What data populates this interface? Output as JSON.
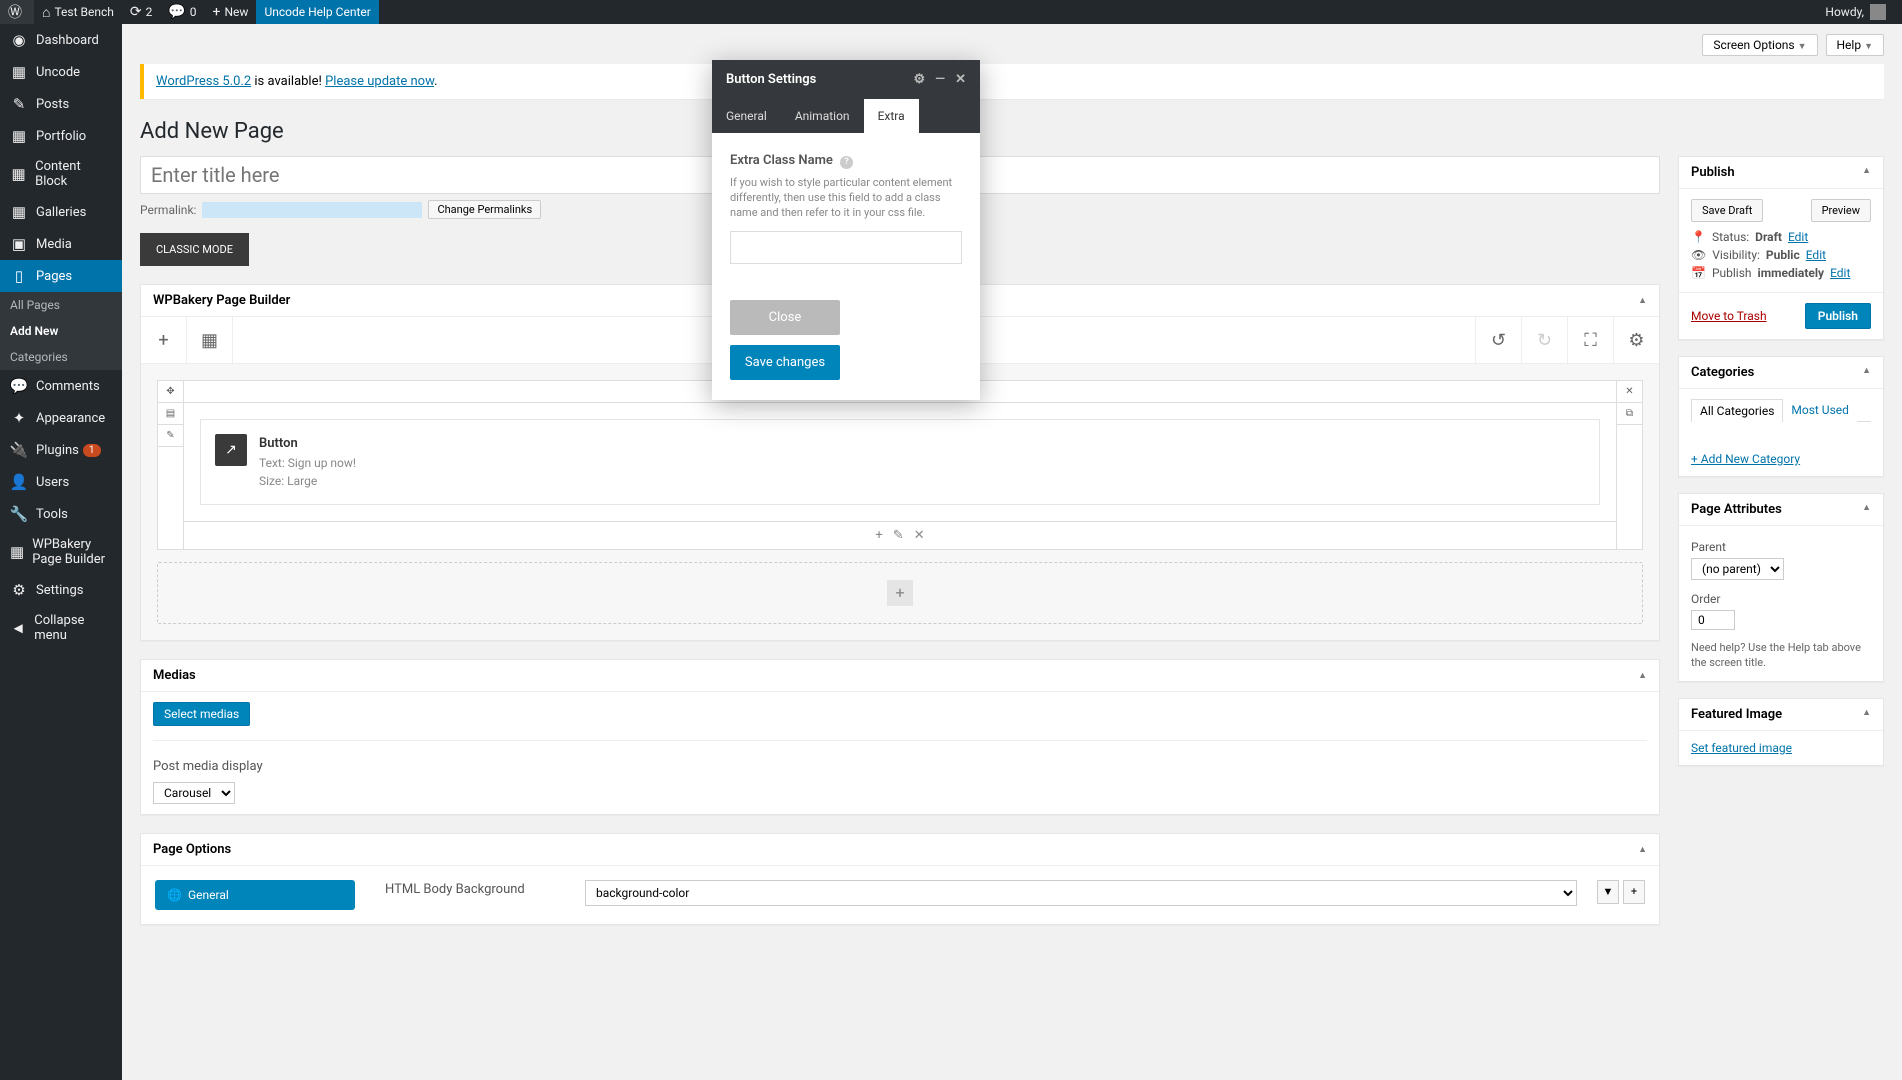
{
  "adminbar": {
    "site_name": "Test Bench",
    "updates": "2",
    "comments": "0",
    "new": "New",
    "help_center": "Uncode Help Center",
    "howdy": "Howdy,"
  },
  "sidebar": {
    "items": [
      {
        "icon": "⚙",
        "label": "Dashboard"
      },
      {
        "icon": "▦",
        "label": "Uncode"
      },
      {
        "icon": "✎",
        "label": "Posts"
      },
      {
        "icon": "▦",
        "label": "Portfolio"
      },
      {
        "icon": "▦",
        "label": "Content Block"
      },
      {
        "icon": "▦",
        "label": "Galleries"
      },
      {
        "icon": "▣",
        "label": "Media"
      },
      {
        "icon": "▯",
        "label": "Pages"
      },
      {
        "icon": "💬",
        "label": "Comments"
      },
      {
        "icon": "✦",
        "label": "Appearance"
      },
      {
        "icon": "🔌",
        "label": "Plugins",
        "badge": "1"
      },
      {
        "icon": "👤",
        "label": "Users"
      },
      {
        "icon": "🔧",
        "label": "Tools"
      },
      {
        "icon": "▦",
        "label": "WPBakery Page Builder"
      },
      {
        "icon": "⚙",
        "label": "Settings"
      },
      {
        "icon": "◄",
        "label": "Collapse menu"
      }
    ],
    "submenu": [
      {
        "label": "All Pages"
      },
      {
        "label": "Add New"
      },
      {
        "label": "Categories"
      }
    ]
  },
  "top": {
    "screen_options": "Screen Options",
    "help": "Help"
  },
  "notice": {
    "pre": "WordPress 5.0.2",
    "mid": " is available! ",
    "link": "Please update now"
  },
  "page": {
    "heading": "Add New Page",
    "title_placeholder": "Enter title here",
    "permalink_label": "Permalink:",
    "change_permalinks": "Change Permalinks",
    "classic_mode": "CLASSIC MODE"
  },
  "wpb": {
    "panel_title": "WPBakery Page Builder",
    "element": {
      "title": "Button",
      "text": "Text: Sign up now!",
      "size": "Size: Large"
    }
  },
  "medias": {
    "title": "Medias",
    "select": "Select medias",
    "post_media_label": "Post media display",
    "carousel": "Carousel"
  },
  "page_options": {
    "title": "Page Options",
    "general_tab": "General",
    "body_bg_label": "HTML Body Background",
    "body_bg_value": "background-color"
  },
  "publish": {
    "title": "Publish",
    "save_draft": "Save Draft",
    "preview": "Preview",
    "status_label": "Status:",
    "status_value": "Draft",
    "visibility_label": "Visibility:",
    "visibility_value": "Public",
    "publish_label": "Publish",
    "publish_value": "immediately",
    "edit": "Edit",
    "trash": "Move to Trash",
    "publish_btn": "Publish"
  },
  "categories": {
    "title": "Categories",
    "tab_all": "All Categories",
    "tab_most": "Most Used",
    "add_new": "+ Add New Category"
  },
  "attributes": {
    "title": "Page Attributes",
    "parent_label": "Parent",
    "parent_value": "(no parent)",
    "order_label": "Order",
    "order_value": "0",
    "help": "Need help? Use the Help tab above the screen title."
  },
  "featured": {
    "title": "Featured Image",
    "link": "Set featured image"
  },
  "modal": {
    "title": "Button Settings",
    "tabs": {
      "general": "General",
      "animation": "Animation",
      "extra": "Extra"
    },
    "field_label": "Extra Class Name",
    "desc": "If you wish to style particular content element differently, then use this field to add a class name and then refer to it in your css file.",
    "close": "Close",
    "save": "Save changes"
  }
}
